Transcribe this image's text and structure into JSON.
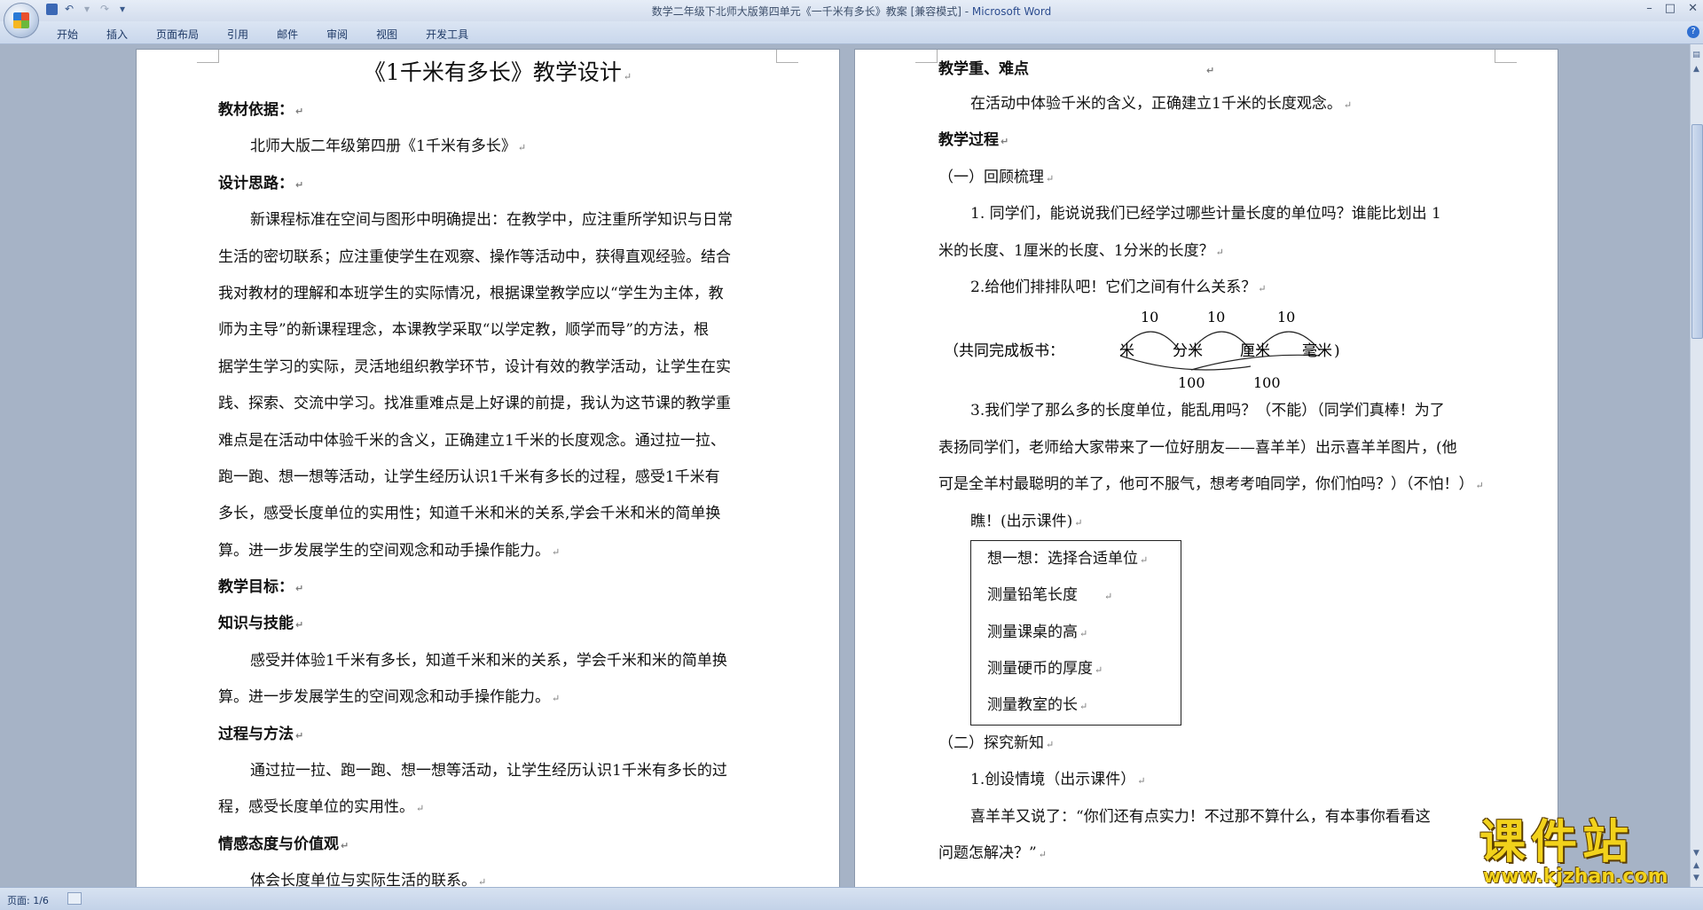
{
  "window": {
    "title": "数学二年级下北师大版第四单元《一千米有多长》教案 [兼容模式] - ",
    "app_name": "Microsoft Word",
    "controls": [
      "–",
      "□",
      "✕"
    ]
  },
  "ribbon": {
    "tabs": [
      "开始",
      "插入",
      "页面布局",
      "引用",
      "邮件",
      "审阅",
      "视图",
      "开发工具"
    ]
  },
  "mark": "↵",
  "left_page": {
    "title": "《1千米有多长》教学设计",
    "h1": "教材依据：",
    "p1": "北师大版二年级第四册《1千米有多长》",
    "h2": "设计思路：",
    "design_lines": [
      "新课程标准在空间与图形中明确提出：在教学中，应注重所学知识与日常",
      "生活的密切联系；应注重使学生在观察、操作等活动中，获得直观经验。结合",
      "我对教材的理解和本班学生的实际情况，根据课堂教学应以“学生为主体，教",
      "师为主导”的新课程理念，本课教学采取“以学定教，顺学而导”的方法，根",
      "据学生学习的实际，灵活地组织教学环节，设计有效的教学活动，让学生在实",
      "践、探索、交流中学习。找准重难点是上好课的前提，我认为这节课的教学重",
      "难点是在活动中体验千米的含义，正确建立1千米的长度观念。通过拉一拉、",
      "跑一跑、想一想等活动，让学生经历认识1千米有多长的过程，感受1千米有",
      "多长，感受长度单位的实用性；知道千米和米的关系,学会千米和米的简单换",
      "算。进一步发展学生的空间观念和动手操作能力。"
    ],
    "h3": "教学目标：",
    "h4": "知识与技能",
    "k_lines": [
      "感受并体验1千米有多长，知道千米和米的关系，学会千米和米的简单换",
      "算。进一步发展学生的空间观念和动手操作能力。"
    ],
    "h5": "过程与方法",
    "m_lines": [
      "通过拉一拉、跑一跑、想一想等活动，让学生经历认识1千米有多长的过",
      "程，感受长度单位的实用性。"
    ],
    "h6": "情感态度与价值观",
    "e_line": "体会长度单位与实际生活的联系。"
  },
  "right_page": {
    "h1": "教学重、难点",
    "p1": "在活动中体验千米的含义，正确建立1千米的长度观念。",
    "h2": "教学过程",
    "s1": "（一）回顾梳理",
    "q1_lines": [
      "1.  同学们，能说说我们已经学过哪些计量长度的单位吗？谁能比划出 1",
      "米的长度、1厘米的长度、1分米的长度？"
    ],
    "q2": "2.给他们排排队吧！它们之间有什么关系？",
    "diagram": {
      "prefix": "（共同完成板书：",
      "units": [
        "米",
        "分米",
        "厘米",
        "毫米"
      ],
      "suffix": ")",
      "top_rates": [
        "10",
        "10",
        "10"
      ],
      "bottom_rates": [
        "100",
        "100"
      ]
    },
    "q3_lines": [
      "3.我们学了那么多的长度单位，能乱用吗？（不能）（同学们真棒！为了",
      "表扬同学们，老师给大家带来了一位好朋友——喜羊羊）出示喜羊羊图片，(他",
      "可是全羊村最聪明的羊了，他可不服气，想考考咱同学，你们怕吗？）（不怕！）"
    ],
    "look": "瞧！(出示课件)",
    "box_items": [
      "想一想：选择合适单位",
      "测量铅笔长度",
      "测量课桌的高",
      "测量硬币的厚度",
      "测量教室的长"
    ],
    "s2": "（二）探究新知",
    "c1": "1.创设情境（出示课件）",
    "x1": "喜羊羊又说了：“你们还有点实力！不过那不算什么，有本事你看看这",
    "x2": "问题怎解决？”"
  },
  "status": {
    "page": "页面: 1/6"
  },
  "watermark": {
    "title": "课件站",
    "url": "www.kjzhan.com"
  }
}
